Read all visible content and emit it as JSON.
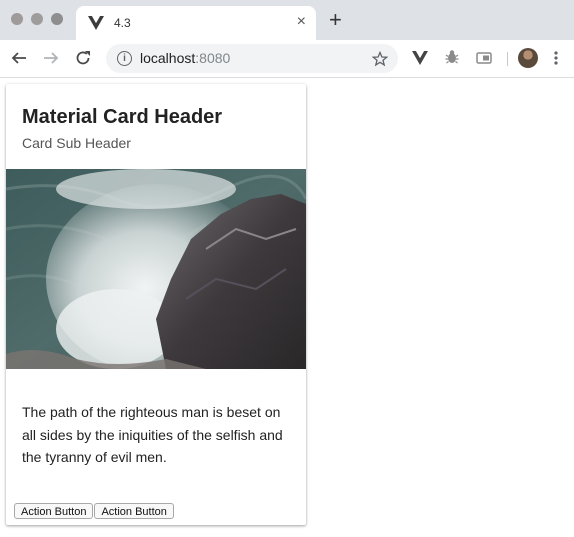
{
  "browser": {
    "tab": {
      "title": "4.3",
      "close_glyph": "×"
    },
    "new_tab_glyph": "+",
    "address": {
      "host": "localhost",
      "port": ":8080"
    },
    "icons": {
      "back": "arrow-left",
      "forward": "arrow-right",
      "reload": "reload",
      "info": "info",
      "star": "star",
      "extensions": [
        "vue-devtools-icon",
        "bug-icon",
        "card-extension-icon"
      ],
      "avatar": "profile-avatar",
      "menu": "kebab-menu"
    }
  },
  "card": {
    "title": "Material Card Header",
    "subtitle": "Card Sub Header",
    "text": "The path of the righteous man is beset on all sides by the iniquities of the selfish and the tyranny of evil men.",
    "actions": [
      "Action Button",
      "Action Button"
    ]
  }
}
